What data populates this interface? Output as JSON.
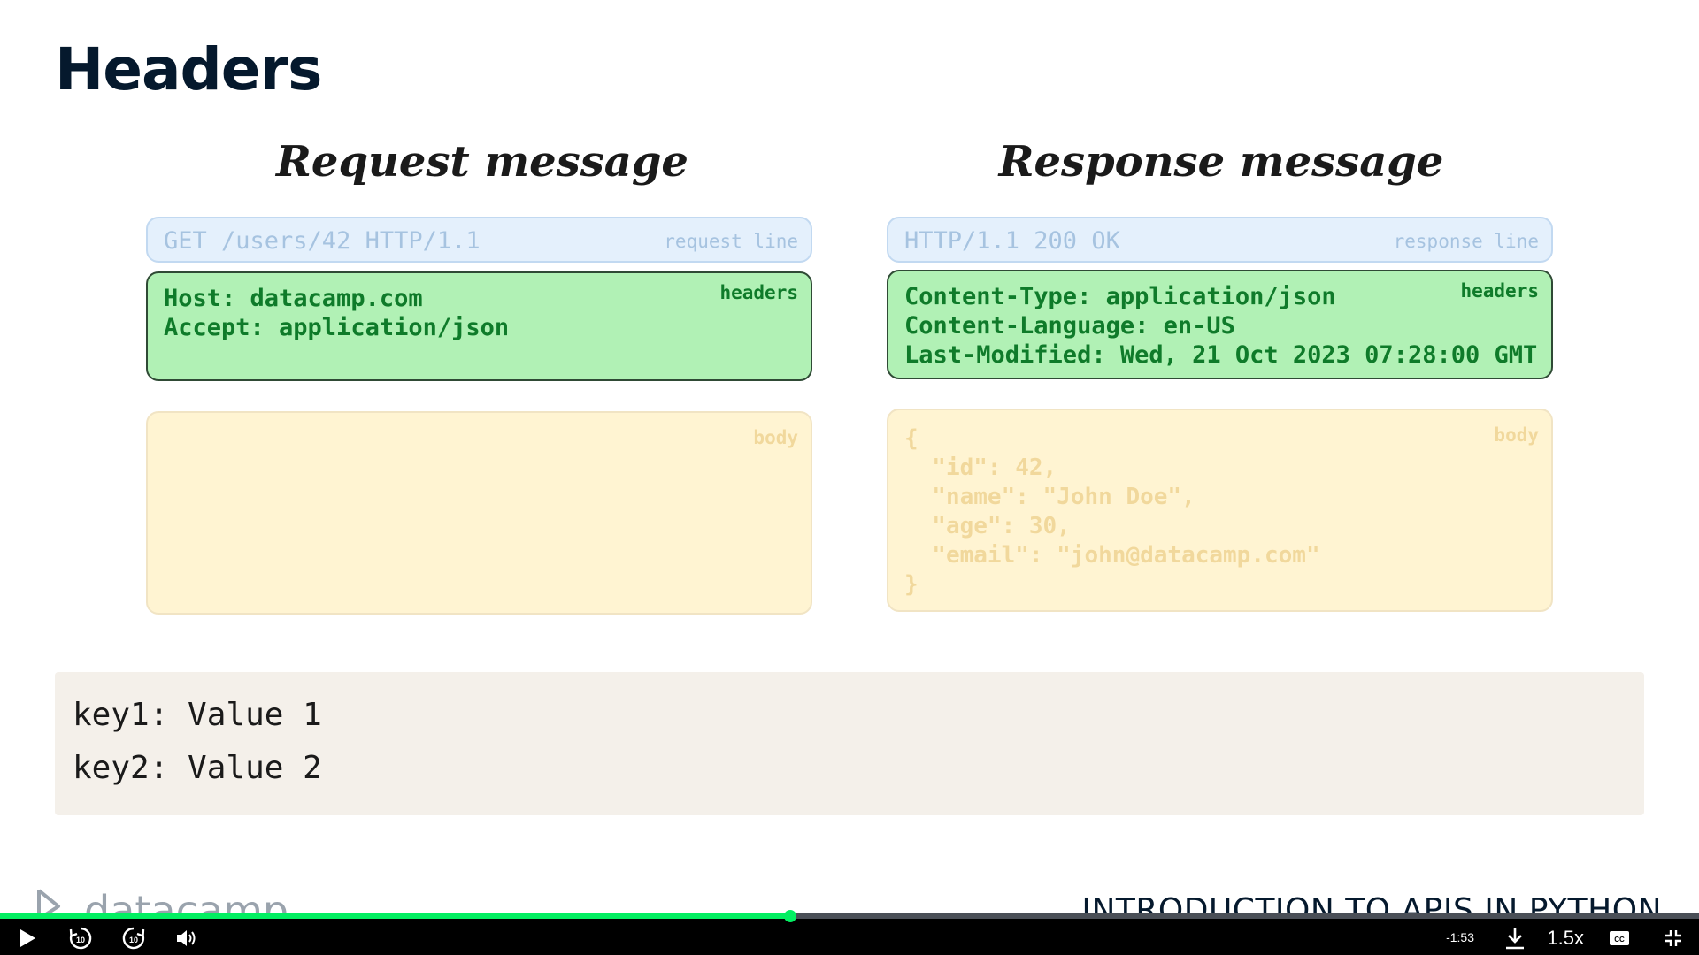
{
  "slide": {
    "title": "Headers"
  },
  "request": {
    "title": "Request message",
    "line": {
      "text": "GET /users/42 HTTP/1.1",
      "tag": "request line"
    },
    "headers": {
      "text": "Host: datacamp.com\nAccept: application/json",
      "tag": "headers"
    },
    "body": {
      "text": "",
      "tag": "body"
    }
  },
  "response": {
    "title": "Response message",
    "line": {
      "text": "HTTP/1.1 200 OK",
      "tag": "response line"
    },
    "headers": {
      "text": "Content-Type: application/json\nContent-Language: en-US\nLast-Modified: Wed, 21 Oct 2023 07:28:00 GMT",
      "tag": "headers"
    },
    "body": {
      "text": "{\n  \"id\": 42,\n  \"name\": \"John Doe\",\n  \"age\": 30,\n  \"email\": \"john@datacamp.com\"\n}",
      "tag": "body"
    }
  },
  "example": {
    "lines": [
      "key1: Value 1",
      "key2: Value 2"
    ]
  },
  "footer": {
    "brand": "datacamp",
    "course": "INTRODUCTION TO APIS IN PYTHON"
  },
  "player": {
    "progress": 0.465,
    "time_remaining": "-1:53",
    "speed": "1.5x",
    "icons": [
      "play-icon",
      "rewind-10-icon",
      "forward-10-icon",
      "volume-icon",
      "download-icon",
      "captions-icon",
      "exit-fullscreen-icon"
    ]
  },
  "colors": {
    "brand_green": "#03ef62",
    "headers_bg": "#b1f1b5",
    "body_bg": "#fff4d2",
    "line_bg": "#e4f0fc"
  }
}
